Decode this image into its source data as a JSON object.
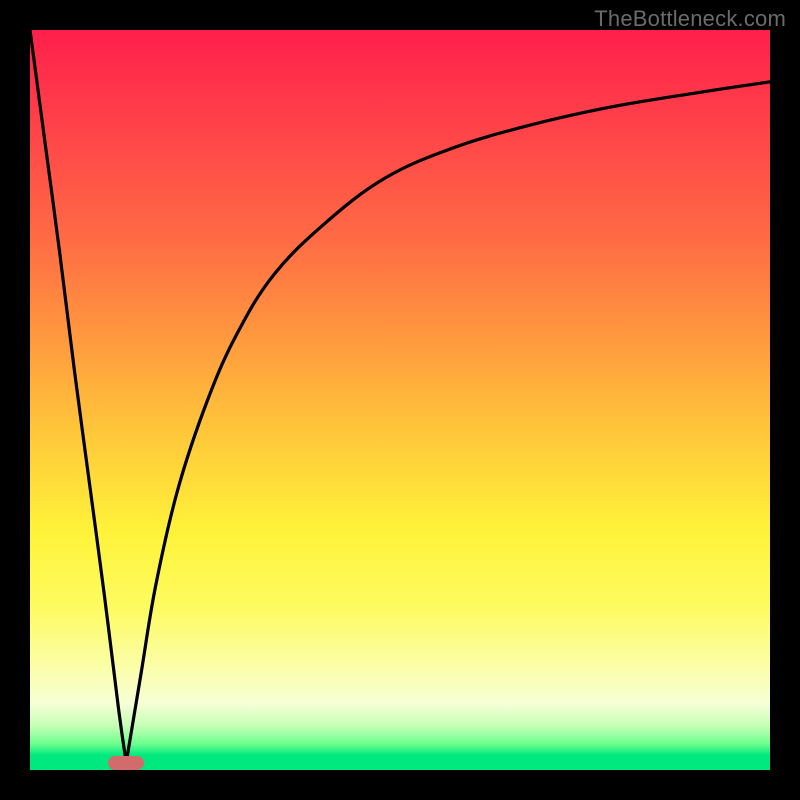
{
  "watermark": "TheBottleneck.com",
  "colors": {
    "frame": "#000000",
    "curve": "#000000",
    "minpoint": "#d26b6c",
    "gradient_top": "#ff1f4b",
    "gradient_bottom": "#00e97e"
  },
  "chart_data": {
    "type": "line",
    "title": "",
    "xlabel": "",
    "ylabel": "",
    "xlim": [
      0,
      100
    ],
    "ylim": [
      0,
      100
    ],
    "grid": false,
    "legend": false,
    "annotations": [
      "TheBottleneck.com"
    ],
    "min_marker": {
      "x": 13,
      "y": 1
    },
    "series": [
      {
        "name": "left-branch",
        "x": [
          0,
          2,
          4,
          6,
          8,
          10,
          12,
          13
        ],
        "y": [
          100,
          85,
          70,
          54,
          39,
          24,
          8,
          1
        ]
      },
      {
        "name": "right-branch",
        "x": [
          13,
          15,
          17,
          20,
          24,
          28,
          33,
          40,
          48,
          57,
          67,
          78,
          90,
          100
        ],
        "y": [
          1,
          13,
          25,
          38,
          50,
          59,
          67,
          74,
          80,
          84,
          87,
          89.5,
          91.5,
          93
        ]
      }
    ]
  }
}
